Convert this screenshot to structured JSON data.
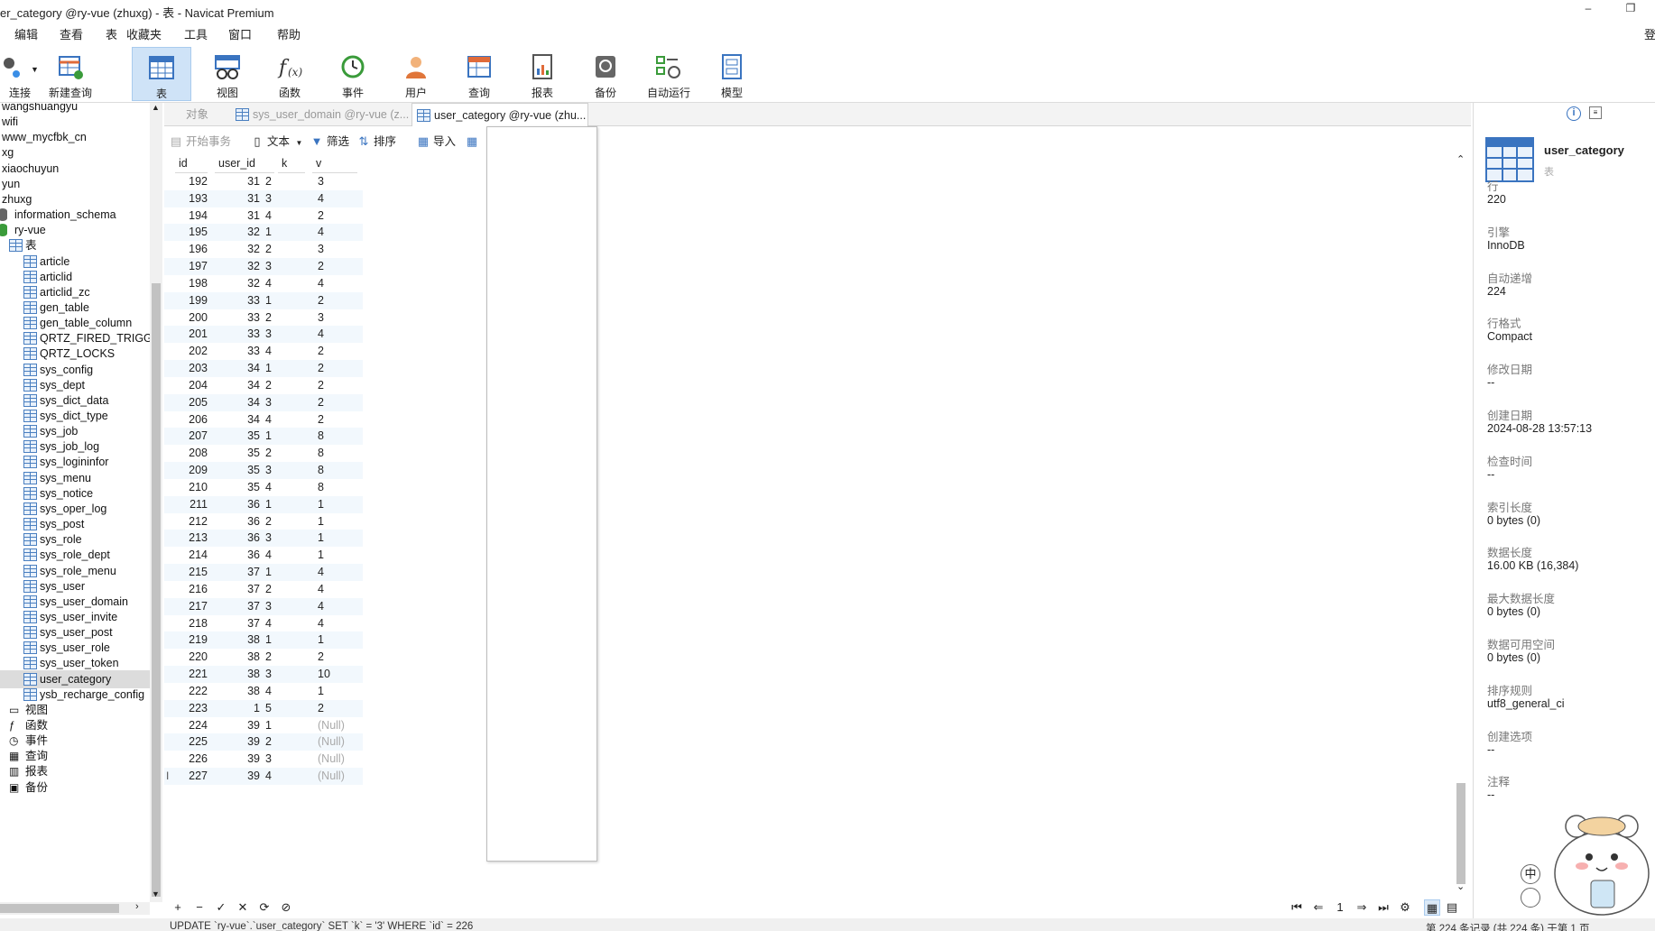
{
  "window": {
    "title": "er_category @ry-vue (zhuxg) - 表 - Navicat Premium",
    "min_glyph": "–",
    "restore_glyph": "❐",
    "right_edge_text": "登"
  },
  "menu": [
    "编辑",
    "查看",
    "表",
    "收藏夹",
    "工具",
    "窗口",
    "帮助"
  ],
  "toolbar": {
    "connection_label": "连接",
    "new_query": "新建查询",
    "buttons": [
      {
        "label": "表",
        "icon": "table-icon",
        "active": true
      },
      {
        "label": "视图",
        "icon": "view-icon",
        "active": false
      },
      {
        "label": "函数",
        "icon": "function-icon",
        "active": false
      },
      {
        "label": "事件",
        "icon": "event-icon",
        "active": false
      },
      {
        "label": "用户",
        "icon": "user-icon",
        "active": false
      },
      {
        "label": "查询",
        "icon": "query-icon",
        "active": false
      },
      {
        "label": "报表",
        "icon": "report-icon",
        "active": false
      },
      {
        "label": "备份",
        "icon": "backup-icon",
        "active": false
      },
      {
        "label": "自动运行",
        "icon": "autorun-icon",
        "active": false
      },
      {
        "label": "模型",
        "icon": "model-icon",
        "active": false
      }
    ]
  },
  "tree": {
    "top_clipped": "wangshuangyu",
    "connections": [
      "wifi",
      "www_mycfbk_cn",
      "xg",
      "xiaochuyun",
      "yun",
      "zhuxg"
    ],
    "databases": [
      "information_schema",
      "ry-vue"
    ],
    "tables_folder": "表",
    "tables": [
      "article",
      "articlid",
      "articlid_zc",
      "gen_table",
      "gen_table_column",
      "QRTZ_FIRED_TRIGGE",
      "QRTZ_LOCKS",
      "sys_config",
      "sys_dept",
      "sys_dict_data",
      "sys_dict_type",
      "sys_job",
      "sys_job_log",
      "sys_logininfor",
      "sys_menu",
      "sys_notice",
      "sys_oper_log",
      "sys_post",
      "sys_role",
      "sys_role_dept",
      "sys_role_menu",
      "sys_user",
      "sys_user_domain",
      "sys_user_invite",
      "sys_user_post",
      "sys_user_role",
      "sys_user_token",
      "user_category",
      "ysb_recharge_config"
    ],
    "selected_table": "user_category",
    "other_folders": [
      "视图",
      "函数",
      "事件",
      "查询",
      "报表",
      "备份"
    ]
  },
  "tabs": [
    {
      "label": "对象",
      "active": false
    },
    {
      "label": "sys_user_domain @ry-vue (z...",
      "active": false
    },
    {
      "label": "user_category @ry-vue (zhu...",
      "active": true
    }
  ],
  "subtoolbar": {
    "begin_transaction": "开始事务",
    "text": "文本",
    "filter": "筛选",
    "sort": "排序",
    "import": "导入"
  },
  "grid": {
    "columns": [
      "id",
      "user_id",
      "k",
      "v"
    ],
    "rows": [
      [
        "192",
        "31",
        "2",
        "3"
      ],
      [
        "193",
        "31",
        "3",
        "4"
      ],
      [
        "194",
        "31",
        "4",
        "2"
      ],
      [
        "195",
        "32",
        "1",
        "4"
      ],
      [
        "196",
        "32",
        "2",
        "3"
      ],
      [
        "197",
        "32",
        "3",
        "2"
      ],
      [
        "198",
        "32",
        "4",
        "4"
      ],
      [
        "199",
        "33",
        "1",
        "2"
      ],
      [
        "200",
        "33",
        "2",
        "3"
      ],
      [
        "201",
        "33",
        "3",
        "4"
      ],
      [
        "202",
        "33",
        "4",
        "2"
      ],
      [
        "203",
        "34",
        "1",
        "2"
      ],
      [
        "204",
        "34",
        "2",
        "2"
      ],
      [
        "205",
        "34",
        "3",
        "2"
      ],
      [
        "206",
        "34",
        "4",
        "2"
      ],
      [
        "207",
        "35",
        "1",
        "8"
      ],
      [
        "208",
        "35",
        "2",
        "8"
      ],
      [
        "209",
        "35",
        "3",
        "8"
      ],
      [
        "210",
        "35",
        "4",
        "8"
      ],
      [
        "211",
        "36",
        "1",
        "1"
      ],
      [
        "212",
        "36",
        "2",
        "1"
      ],
      [
        "213",
        "36",
        "3",
        "1"
      ],
      [
        "214",
        "36",
        "4",
        "1"
      ],
      [
        "215",
        "37",
        "1",
        "4"
      ],
      [
        "216",
        "37",
        "2",
        "4"
      ],
      [
        "217",
        "37",
        "3",
        "4"
      ],
      [
        "218",
        "37",
        "4",
        "4"
      ],
      [
        "219",
        "38",
        "1",
        "1"
      ],
      [
        "220",
        "38",
        "2",
        "2"
      ],
      [
        "221",
        "38",
        "3",
        "10"
      ],
      [
        "222",
        "38",
        "4",
        "1"
      ],
      [
        "223",
        "1",
        "5",
        "2"
      ],
      [
        "224",
        "39",
        "1",
        "(Null)"
      ],
      [
        "225",
        "39",
        "2",
        "(Null)"
      ],
      [
        "226",
        "39",
        "3",
        "(Null)"
      ],
      [
        "227",
        "39",
        "4",
        "(Null)"
      ]
    ],
    "current_row_marker": "I"
  },
  "bottombar": {
    "page": "1",
    "buttons": [
      "+",
      "−",
      "✓",
      "✕",
      "⟳",
      "⊘"
    ]
  },
  "status": {
    "sql": "UPDATE `ry-vue`.`user_category` SET `k` = '3' WHERE `id` = 226",
    "records": "第 224 条记录 (共 224 条) 于第 1 页"
  },
  "rightpanel": {
    "name": "user_category",
    "type": "表",
    "props": [
      {
        "label": "行",
        "value": "220"
      },
      {
        "label": "引擎",
        "value": "InnoDB"
      },
      {
        "label": "自动递增",
        "value": "224"
      },
      {
        "label": "行格式",
        "value": "Compact"
      },
      {
        "label": "修改日期",
        "value": "--"
      },
      {
        "label": "创建日期",
        "value": "2024-08-28 13:57:13"
      },
      {
        "label": "检查时间",
        "value": "--"
      },
      {
        "label": "索引长度",
        "value": "0 bytes (0)"
      },
      {
        "label": "数据长度",
        "value": "16.00 KB (16,384)"
      },
      {
        "label": "最大数据长度",
        "value": "0 bytes (0)"
      },
      {
        "label": "数据可用空间",
        "value": "0 bytes (0)"
      },
      {
        "label": "排序规则",
        "value": "utf8_general_ci"
      },
      {
        "label": "创建选项",
        "value": "--"
      },
      {
        "label": "注释",
        "value": "--"
      }
    ],
    "ime_label": "中"
  },
  "colors": {
    "accent": "#3a74c0",
    "active_tab_bg": "#cfe3f7",
    "alt_row": "#f2f8fd",
    "null_text": "#aaaaaa"
  }
}
